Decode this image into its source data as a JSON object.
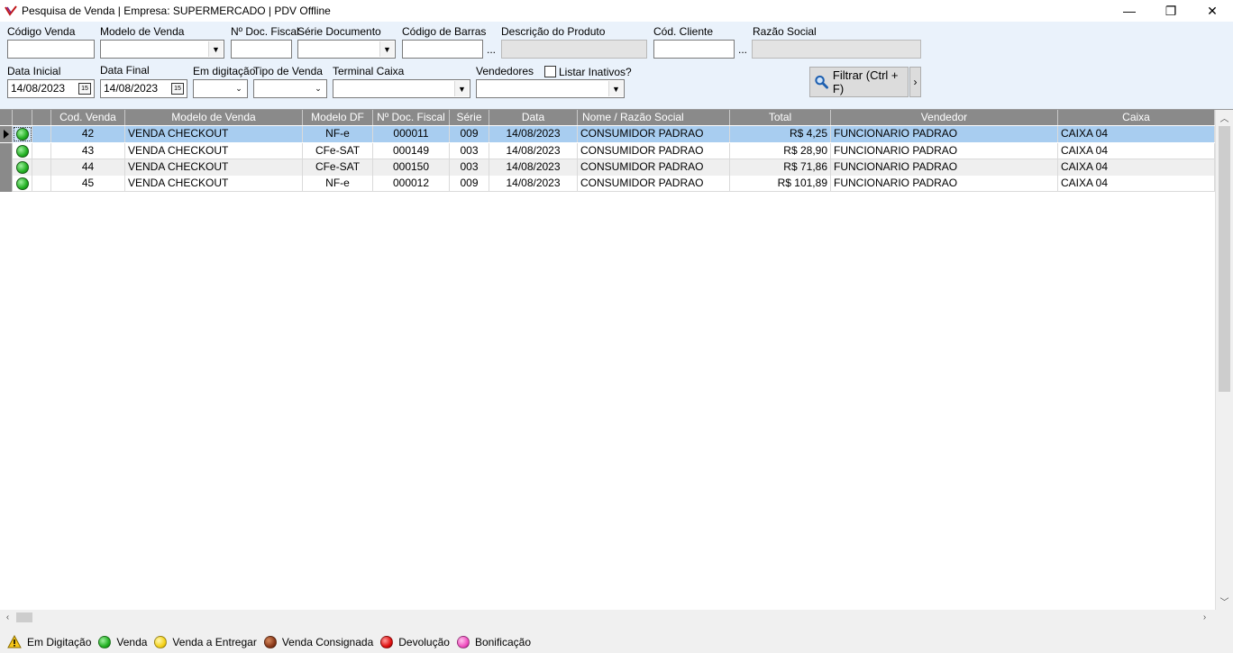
{
  "window": {
    "title": "Pesquisa de Venda | Empresa: SUPERMERCADO | PDV Offline",
    "minimize": "—",
    "restore": "❐",
    "close": "✕"
  },
  "filters": {
    "codigo_venda": {
      "label": "Código Venda",
      "value": ""
    },
    "modelo_venda": {
      "label": "Modelo de Venda",
      "value": ""
    },
    "n_doc_fiscal": {
      "label": "Nº Doc. Fiscal",
      "value": ""
    },
    "serie_documento": {
      "label": "Série Documento",
      "value": ""
    },
    "codigo_barras": {
      "label": "Código de Barras",
      "value": "",
      "button": "..."
    },
    "descricao_produto": {
      "label": "Descrição do Produto",
      "value": ""
    },
    "cod_cliente": {
      "label": "Cód. Cliente",
      "value": "",
      "button": "..."
    },
    "razao_social": {
      "label": "Razão Social",
      "value": ""
    },
    "data_inicial": {
      "label": "Data Inicial",
      "value": "14/08/2023"
    },
    "data_final": {
      "label": "Data Final",
      "value": "14/08/2023"
    },
    "em_digitacao": {
      "label": "Em digitação",
      "value": ""
    },
    "tipo_venda": {
      "label": "Tipo de Venda",
      "value": ""
    },
    "terminal_caixa": {
      "label": "Terminal Caixa",
      "value": ""
    },
    "vendedores": {
      "label": "Vendedores",
      "value": ""
    },
    "listar_inativos": {
      "label": "Listar Inativos?",
      "checked": false
    },
    "filter_button": "Filtrar (Ctrl + F)",
    "filter_more": "›",
    "calendar_glyph": "15"
  },
  "grid": {
    "columns": [
      "",
      "",
      "Cod. Venda",
      "Modelo de Venda",
      "Modelo DF",
      "Nº Doc. Fiscal",
      "Série",
      "Data",
      "Nome / Razão Social",
      "Total",
      "Vendedor",
      "Caixa"
    ],
    "rows": [
      {
        "cod": "42",
        "modelo": "VENDA CHECKOUT",
        "df": "NF-e",
        "doc": "000011",
        "serie": "009",
        "data": "14/08/2023",
        "nome": "CONSUMIDOR PADRAO",
        "total": "R$ 4,25",
        "vendedor": "FUNCIONARIO PADRAO",
        "caixa": "CAIXA 04"
      },
      {
        "cod": "43",
        "modelo": "VENDA CHECKOUT",
        "df": "CFe-SAT",
        "doc": "000149",
        "serie": "003",
        "data": "14/08/2023",
        "nome": "CONSUMIDOR PADRAO",
        "total": "R$ 28,90",
        "vendedor": "FUNCIONARIO PADRAO",
        "caixa": "CAIXA 04"
      },
      {
        "cod": "44",
        "modelo": "VENDA CHECKOUT",
        "df": "CFe-SAT",
        "doc": "000150",
        "serie": "003",
        "data": "14/08/2023",
        "nome": "CONSUMIDOR PADRAO",
        "total": "R$ 71,86",
        "vendedor": "FUNCIONARIO PADRAO",
        "caixa": "CAIXA 04"
      },
      {
        "cod": "45",
        "modelo": "VENDA CHECKOUT",
        "df": "NF-e",
        "doc": "000012",
        "serie": "009",
        "data": "14/08/2023",
        "nome": "CONSUMIDOR PADRAO",
        "total": "R$ 101,89",
        "vendedor": "FUNCIONARIO PADRAO",
        "caixa": "CAIXA 04"
      }
    ]
  },
  "legend": {
    "em_digitacao": "Em Digitação",
    "venda": "Venda",
    "venda_entregar": "Venda a Entregar",
    "venda_consignada": "Venda Consignada",
    "devolucao": "Devolução",
    "bonificacao": "Bonificação"
  },
  "colors": {
    "venda": "#22b022",
    "venda_entregar": "#f5d21a",
    "venda_consignada": "#8b3a1a",
    "devolucao": "#e01010",
    "bonificacao": "#f050c0",
    "selected_row": "#a8cdf0",
    "header": "#8a8a8a"
  },
  "icons": {
    "app": "app-logo-icon",
    "search": "search-icon",
    "warning": "warning-icon"
  }
}
